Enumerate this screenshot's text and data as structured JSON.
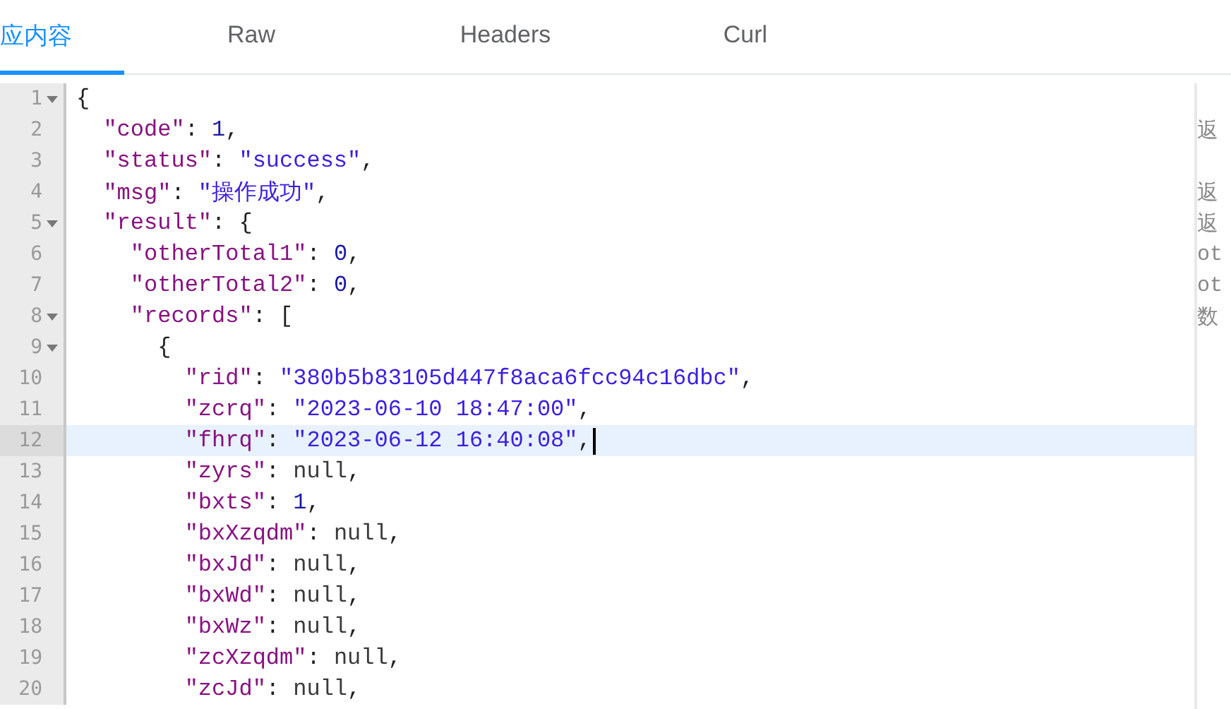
{
  "tabs": [
    {
      "label": "应内容",
      "selected": true
    },
    {
      "label": "Raw",
      "selected": false
    },
    {
      "label": "Headers",
      "selected": false
    },
    {
      "label": "Curl",
      "selected": false
    }
  ],
  "editor": {
    "lines": [
      {
        "number": "1",
        "foldable": true,
        "active": false,
        "tokens": [
          {
            "kind": "punct",
            "text": "{"
          }
        ],
        "children": [
          {
            "number": "2",
            "foldable": false,
            "active": false,
            "tokens": [
              {
                "kind": "key",
                "text": "\"code\""
              },
              {
                "kind": "punct",
                "text": ": "
              },
              {
                "kind": "number",
                "text": "1"
              },
              {
                "kind": "punct",
                "text": ","
              }
            ],
            "comment": "返"
          },
          {
            "number": "3",
            "foldable": false,
            "active": false,
            "tokens": [
              {
                "kind": "key",
                "text": "\"status\""
              },
              {
                "kind": "punct",
                "text": ": "
              },
              {
                "kind": "string",
                "text": "\"success\""
              },
              {
                "kind": "punct",
                "text": ","
              }
            ]
          },
          {
            "number": "4",
            "foldable": false,
            "active": false,
            "tokens": [
              {
                "kind": "key",
                "text": "\"msg\""
              },
              {
                "kind": "punct",
                "text": ": "
              },
              {
                "kind": "string",
                "text": "\"操作成功\""
              },
              {
                "kind": "punct",
                "text": ","
              }
            ],
            "comment": "返"
          },
          {
            "number": "5",
            "foldable": true,
            "active": false,
            "tokens": [
              {
                "kind": "key",
                "text": "\"result\""
              },
              {
                "kind": "punct",
                "text": ": {"
              }
            ],
            "comment": "返",
            "children": [
              {
                "number": "6",
                "foldable": false,
                "active": false,
                "tokens": [
                  {
                    "kind": "key",
                    "text": "\"otherTotal1\""
                  },
                  {
                    "kind": "punct",
                    "text": ": "
                  },
                  {
                    "kind": "number",
                    "text": "0"
                  },
                  {
                    "kind": "punct",
                    "text": ","
                  }
                ],
                "comment": "ot"
              },
              {
                "number": "7",
                "foldable": false,
                "active": false,
                "tokens": [
                  {
                    "kind": "key",
                    "text": "\"otherTotal2\""
                  },
                  {
                    "kind": "punct",
                    "text": ": "
                  },
                  {
                    "kind": "number",
                    "text": "0"
                  },
                  {
                    "kind": "punct",
                    "text": ","
                  }
                ],
                "comment": "ot"
              },
              {
                "number": "8",
                "foldable": true,
                "active": false,
                "tokens": [
                  {
                    "kind": "key",
                    "text": "\"records\""
                  },
                  {
                    "kind": "punct",
                    "text": ": ["
                  }
                ],
                "comment": "数",
                "children": [
                  {
                    "number": "9",
                    "foldable": true,
                    "active": false,
                    "tokens": [
                      {
                        "kind": "punct",
                        "text": "{"
                      }
                    ],
                    "children": [
                      {
                        "number": "10",
                        "foldable": false,
                        "active": false,
                        "tokens": [
                          {
                            "kind": "key",
                            "text": "\"rid\""
                          },
                          {
                            "kind": "punct",
                            "text": ": "
                          },
                          {
                            "kind": "string",
                            "text": "\"380b5b83105d447f8aca6fcc94c16dbc\""
                          },
                          {
                            "kind": "punct",
                            "text": ","
                          }
                        ]
                      },
                      {
                        "number": "11",
                        "foldable": false,
                        "active": false,
                        "tokens": [
                          {
                            "kind": "key",
                            "text": "\"zcrq\""
                          },
                          {
                            "kind": "punct",
                            "text": ": "
                          },
                          {
                            "kind": "string",
                            "text": "\"2023-06-10 18:47:00\""
                          },
                          {
                            "kind": "punct",
                            "text": ","
                          }
                        ]
                      },
                      {
                        "number": "12",
                        "foldable": false,
                        "active": true,
                        "tokens": [
                          {
                            "kind": "key",
                            "text": "\"fhrq\""
                          },
                          {
                            "kind": "punct",
                            "text": ": "
                          },
                          {
                            "kind": "string",
                            "text": "\"2023-06-12 16:40:08\""
                          },
                          {
                            "kind": "punct",
                            "text": ","
                          }
                        ]
                      },
                      {
                        "number": "13",
                        "foldable": false,
                        "active": false,
                        "tokens": [
                          {
                            "kind": "key",
                            "text": "\"zyrs\""
                          },
                          {
                            "kind": "punct",
                            "text": ": "
                          },
                          {
                            "kind": "null",
                            "text": "null"
                          },
                          {
                            "kind": "punct",
                            "text": ","
                          }
                        ]
                      },
                      {
                        "number": "14",
                        "foldable": false,
                        "active": false,
                        "tokens": [
                          {
                            "kind": "key",
                            "text": "\"bxts\""
                          },
                          {
                            "kind": "punct",
                            "text": ": "
                          },
                          {
                            "kind": "number",
                            "text": "1"
                          },
                          {
                            "kind": "punct",
                            "text": ","
                          }
                        ]
                      },
                      {
                        "number": "15",
                        "foldable": false,
                        "active": false,
                        "tokens": [
                          {
                            "kind": "key",
                            "text": "\"bxXzqdm\""
                          },
                          {
                            "kind": "punct",
                            "text": ": "
                          },
                          {
                            "kind": "null",
                            "text": "null"
                          },
                          {
                            "kind": "punct",
                            "text": ","
                          }
                        ]
                      },
                      {
                        "number": "16",
                        "foldable": false,
                        "active": false,
                        "tokens": [
                          {
                            "kind": "key",
                            "text": "\"bxJd\""
                          },
                          {
                            "kind": "punct",
                            "text": ": "
                          },
                          {
                            "kind": "null",
                            "text": "null"
                          },
                          {
                            "kind": "punct",
                            "text": ","
                          }
                        ]
                      },
                      {
                        "number": "17",
                        "foldable": false,
                        "active": false,
                        "tokens": [
                          {
                            "kind": "key",
                            "text": "\"bxWd\""
                          },
                          {
                            "kind": "punct",
                            "text": ": "
                          },
                          {
                            "kind": "null",
                            "text": "null"
                          },
                          {
                            "kind": "punct",
                            "text": ","
                          }
                        ]
                      },
                      {
                        "number": "18",
                        "foldable": false,
                        "active": false,
                        "tokens": [
                          {
                            "kind": "key",
                            "text": "\"bxWz\""
                          },
                          {
                            "kind": "punct",
                            "text": ": "
                          },
                          {
                            "kind": "null",
                            "text": "null"
                          },
                          {
                            "kind": "punct",
                            "text": ","
                          }
                        ]
                      },
                      {
                        "number": "19",
                        "foldable": false,
                        "active": false,
                        "tokens": [
                          {
                            "kind": "key",
                            "text": "\"zcXzqdm\""
                          },
                          {
                            "kind": "punct",
                            "text": ": "
                          },
                          {
                            "kind": "null",
                            "text": "null"
                          },
                          {
                            "kind": "punct",
                            "text": ","
                          }
                        ]
                      },
                      {
                        "number": "20",
                        "foldable": false,
                        "active": false,
                        "tokens": [
                          {
                            "kind": "key",
                            "text": "\"zcJd\""
                          },
                          {
                            "kind": "punct",
                            "text": ": "
                          },
                          {
                            "kind": "null",
                            "text": "null"
                          },
                          {
                            "kind": "punct",
                            "text": ","
                          }
                        ]
                      }
                    ]
                  }
                ]
              }
            ]
          }
        ]
      }
    ]
  }
}
